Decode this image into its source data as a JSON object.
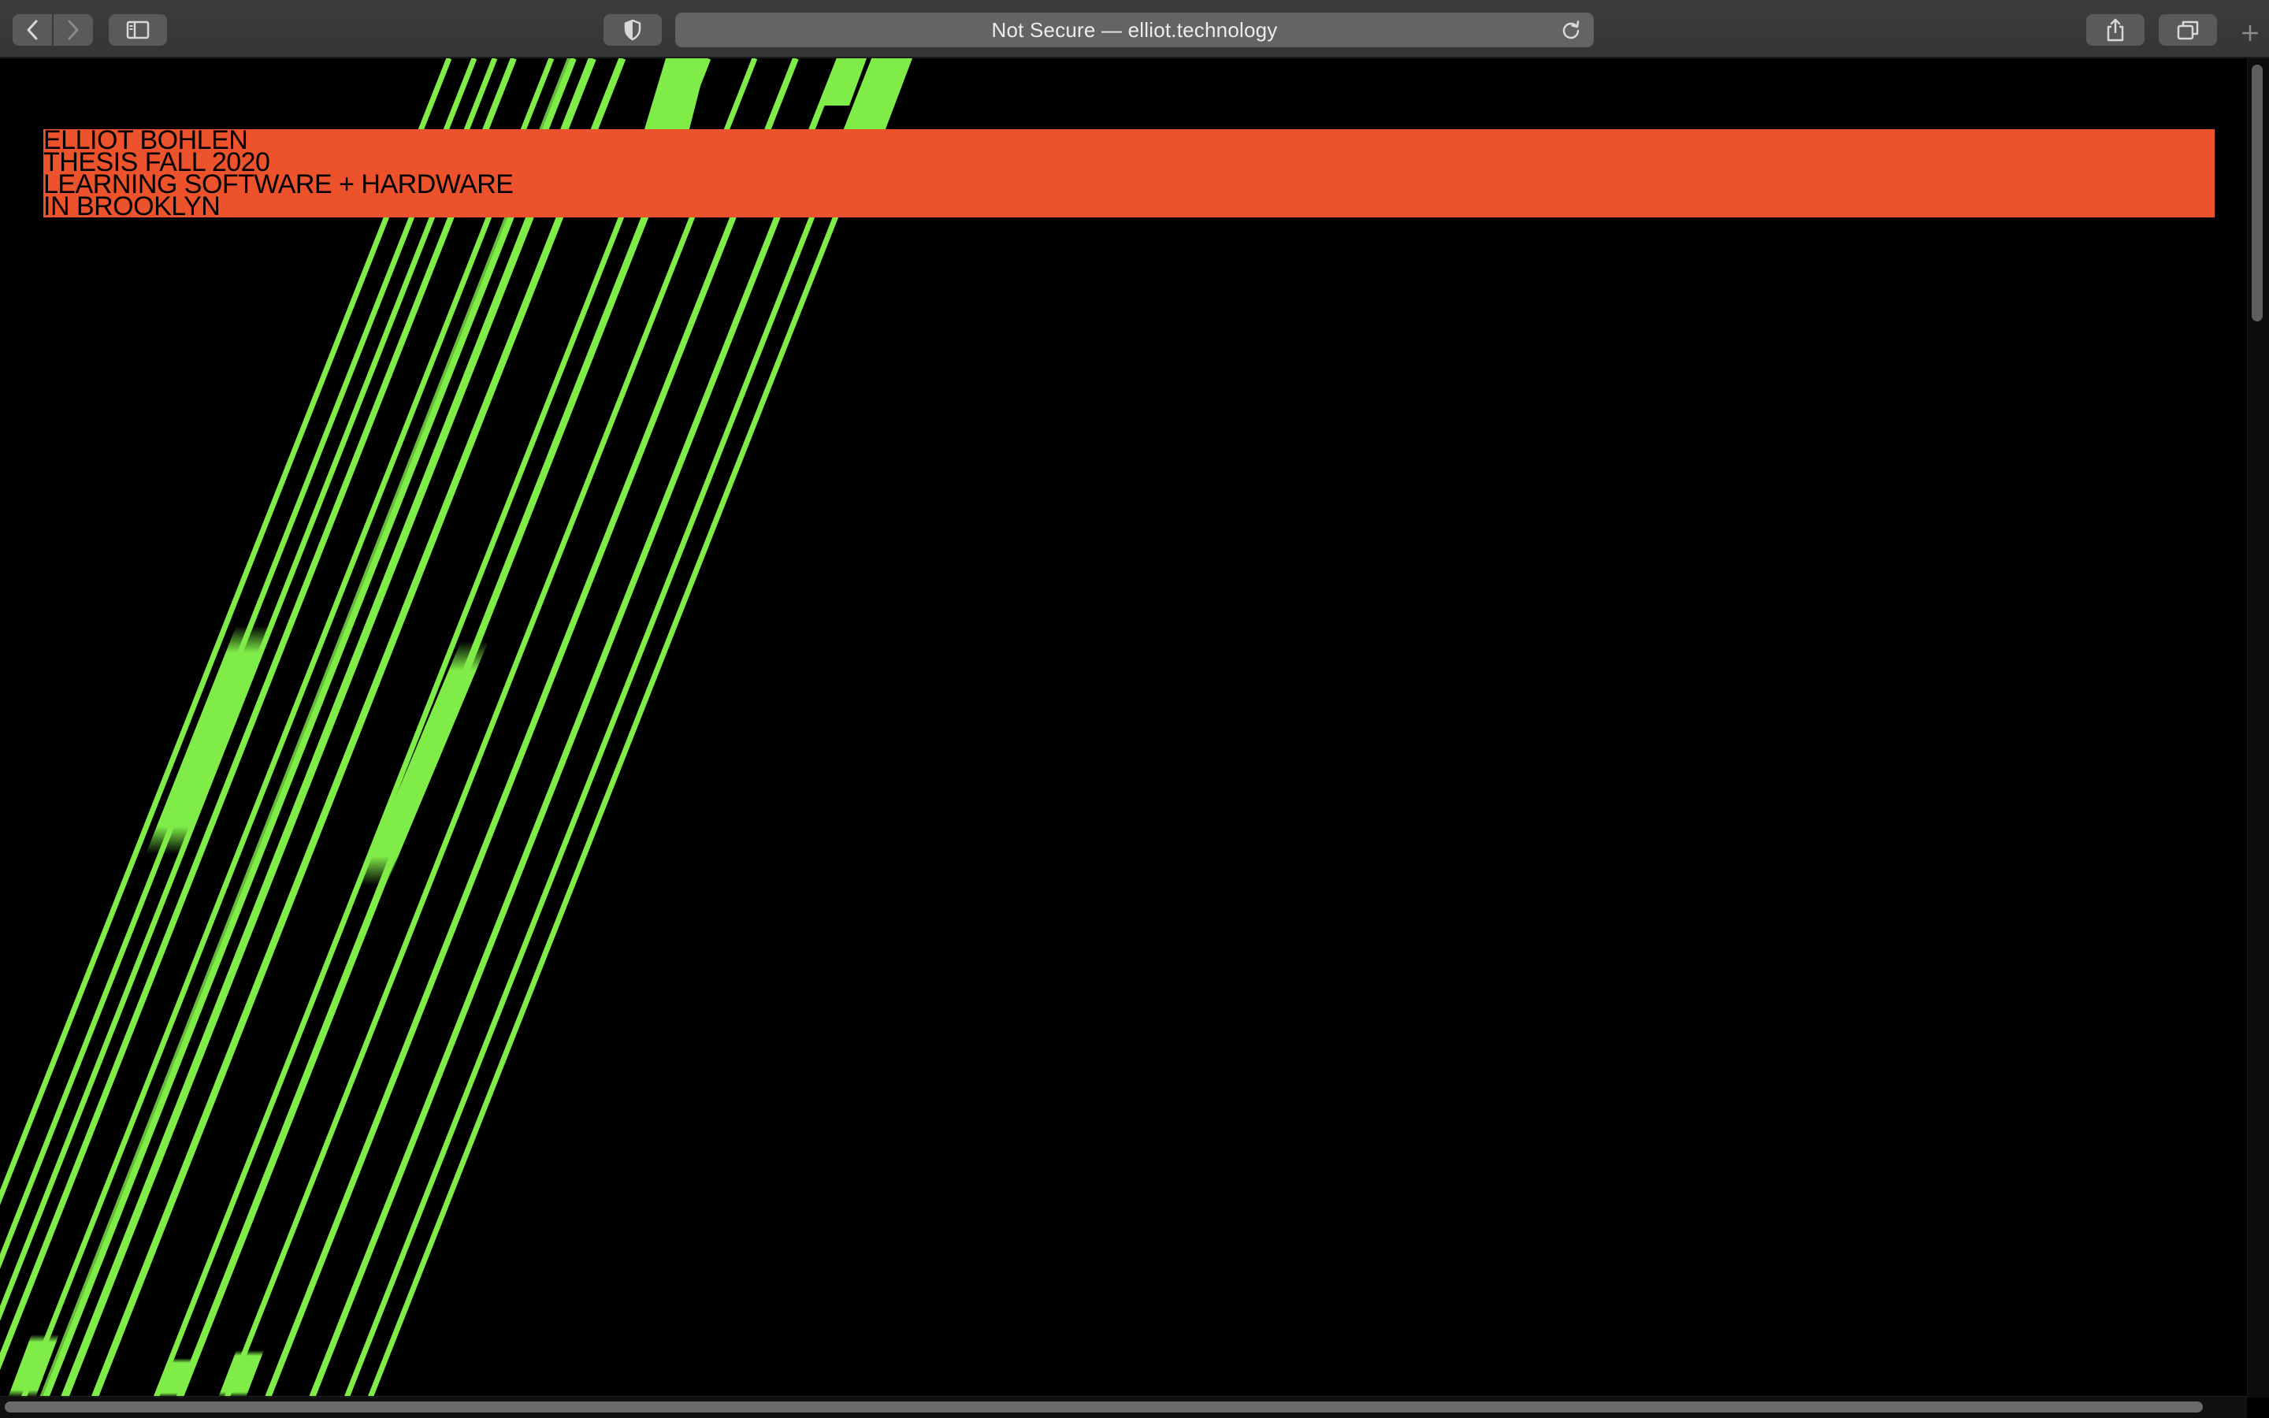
{
  "browser": {
    "address_text": "Not Secure — elliot.technology",
    "icons": [
      "chevron-left-icon",
      "chevron-right-icon",
      "sidebar-icon",
      "privacy-shield-icon",
      "reload-icon",
      "share-icon",
      "tabs-overview-icon",
      "plus-icon"
    ]
  },
  "page": {
    "banner_lines": [
      "ELLIOT BOHLEN",
      "THESIS FALL 2020",
      "LEARNING SOFTWARE + HARDWARE",
      "IN BROOKLYN"
    ],
    "colors": {
      "background": "#000000",
      "banner": "#ec522b",
      "stripes": "#7fec48"
    }
  }
}
